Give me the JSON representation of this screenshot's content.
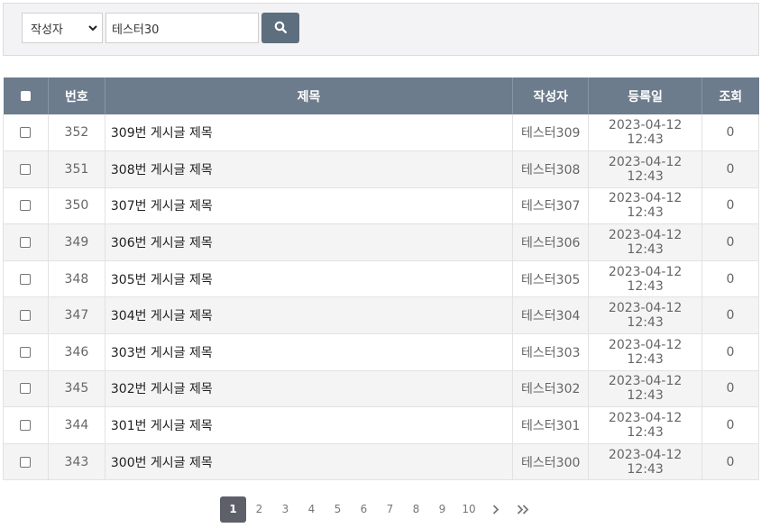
{
  "search": {
    "field_selected": "작성자",
    "query_value": "테스터30",
    "button_icon": "search-icon"
  },
  "table": {
    "headers": {
      "number": "번호",
      "title": "제목",
      "author": "작성자",
      "date": "등록일",
      "views": "조회"
    },
    "rows": [
      {
        "number": "352",
        "title": "309번 게시글 제목",
        "author": "테스터309",
        "date": "2023-04-12 12:43",
        "views": "0"
      },
      {
        "number": "351",
        "title": "308번 게시글 제목",
        "author": "테스터308",
        "date": "2023-04-12 12:43",
        "views": "0"
      },
      {
        "number": "350",
        "title": "307번 게시글 제목",
        "author": "테스터307",
        "date": "2023-04-12 12:43",
        "views": "0"
      },
      {
        "number": "349",
        "title": "306번 게시글 제목",
        "author": "테스터306",
        "date": "2023-04-12 12:43",
        "views": "0"
      },
      {
        "number": "348",
        "title": "305번 게시글 제목",
        "author": "테스터305",
        "date": "2023-04-12 12:43",
        "views": "0"
      },
      {
        "number": "347",
        "title": "304번 게시글 제목",
        "author": "테스터304",
        "date": "2023-04-12 12:43",
        "views": "0"
      },
      {
        "number": "346",
        "title": "303번 게시글 제목",
        "author": "테스터303",
        "date": "2023-04-12 12:43",
        "views": "0"
      },
      {
        "number": "345",
        "title": "302번 게시글 제목",
        "author": "테스터302",
        "date": "2023-04-12 12:43",
        "views": "0"
      },
      {
        "number": "344",
        "title": "301번 게시글 제목",
        "author": "테스터301",
        "date": "2023-04-12 12:43",
        "views": "0"
      },
      {
        "number": "343",
        "title": "300번 게시글 제목",
        "author": "테스터300",
        "date": "2023-04-12 12:43",
        "views": "0"
      }
    ]
  },
  "pagination": {
    "current": "1",
    "pages": [
      "1",
      "2",
      "3",
      "4",
      "5",
      "6",
      "7",
      "8",
      "9",
      "10"
    ],
    "next_icon": "chevron-right-icon",
    "last_icon": "double-chevron-right-icon"
  },
  "colors": {
    "header_bg": "#6c7c8c",
    "button_bg": "#5d6e7e",
    "active_page_bg": "#5d6068"
  }
}
